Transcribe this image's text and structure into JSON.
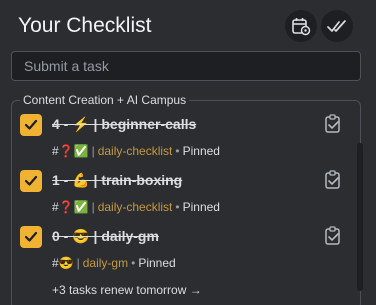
{
  "header": {
    "title": "Your Checklist"
  },
  "toolbar": {
    "schedule_icon": "calendar-gear-icon",
    "checkall_icon": "double-check-icon"
  },
  "input": {
    "placeholder": "Submit a task"
  },
  "group": {
    "label": "Content Creation + AI Campus"
  },
  "items": [
    {
      "title": "4 - ⚡ | beginner-calls",
      "tag": "#❓✅",
      "channel": "daily-checklist",
      "status": "Pinned"
    },
    {
      "title": "1 - 💪 | train-boxing",
      "tag": "#❓✅",
      "channel": "daily-checklist",
      "status": "Pinned"
    },
    {
      "title": "0 - 😎 | daily-gm",
      "tag": "#😎",
      "channel": "daily-gm",
      "status": "Pinned"
    }
  ],
  "footer": {
    "more": "+3 tasks renew tomorrow →"
  },
  "colors": {
    "accent": "#f0b232",
    "background": "#2b2d31",
    "channel": "#c59a3c"
  }
}
